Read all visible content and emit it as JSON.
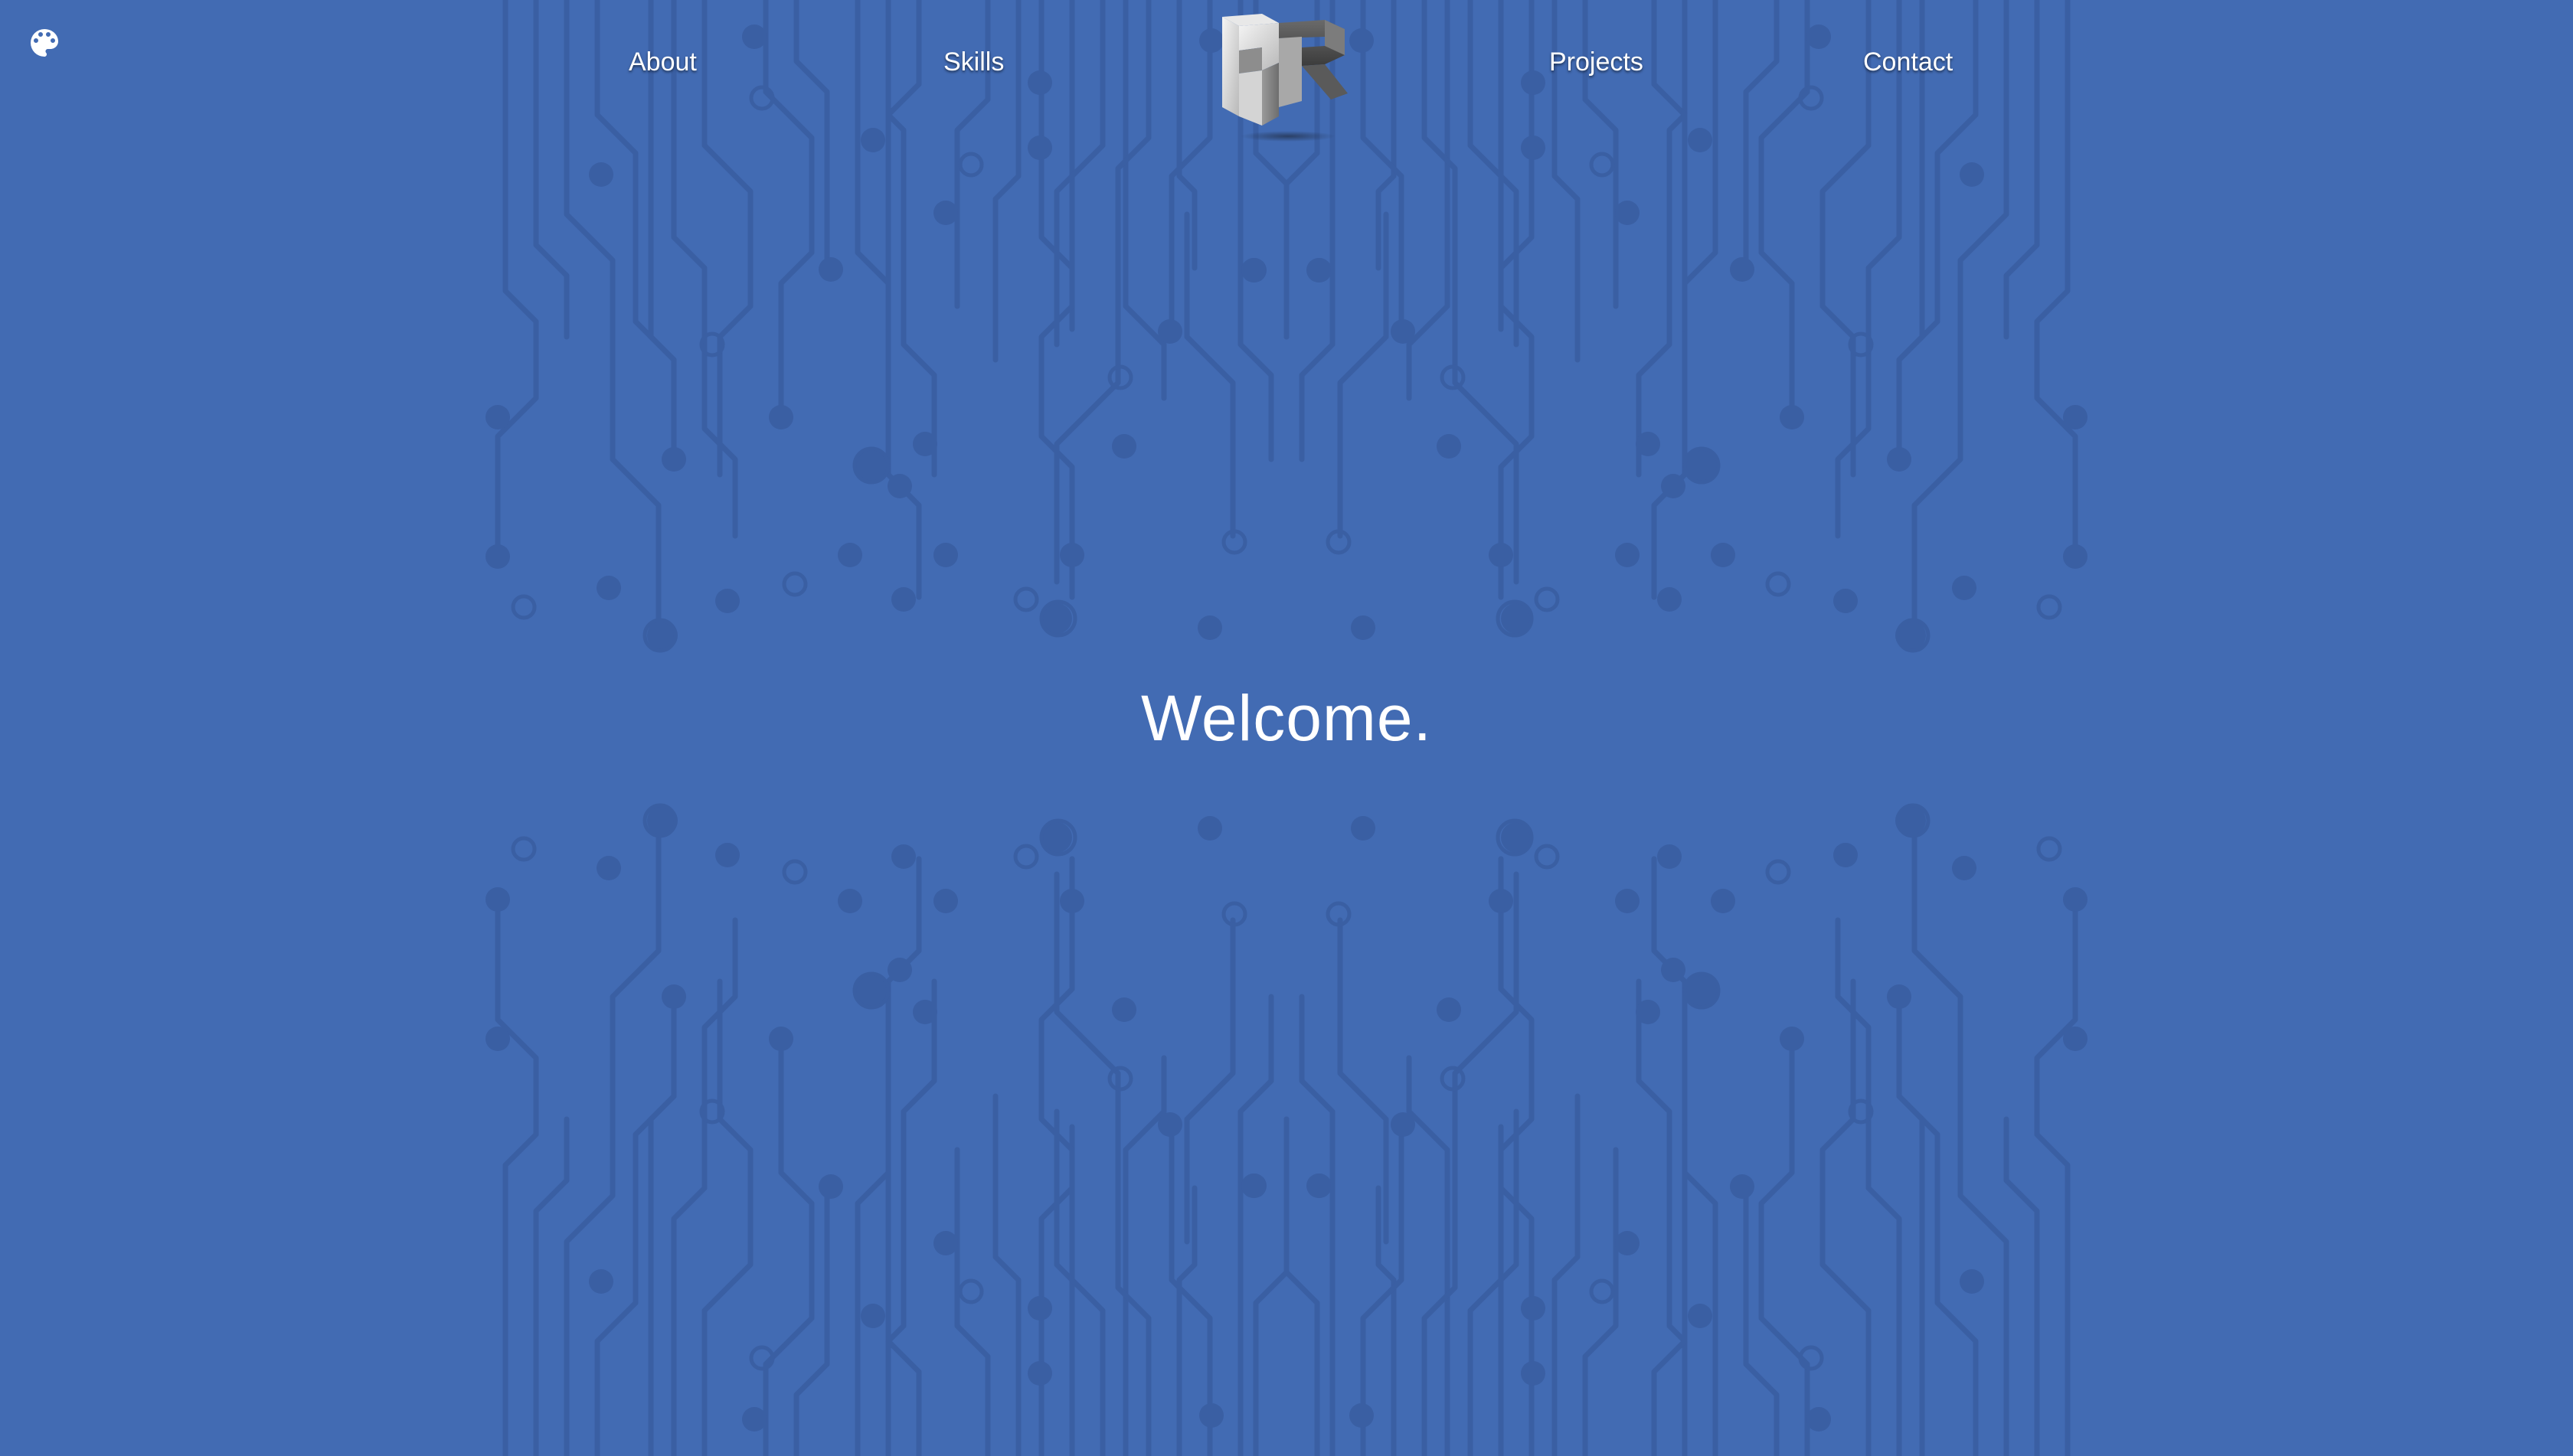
{
  "nav": {
    "about_label": "About",
    "skills_label": "Skills",
    "projects_label": "Projects",
    "contact_label": "Contact"
  },
  "logo": {
    "letters": "AR"
  },
  "hero": {
    "title": "Welcome."
  },
  "colors": {
    "background": "#426bb3",
    "circuit": "#3a5fa3",
    "text": "#ffffff"
  },
  "icons": {
    "theme_toggle": "palette-icon"
  }
}
